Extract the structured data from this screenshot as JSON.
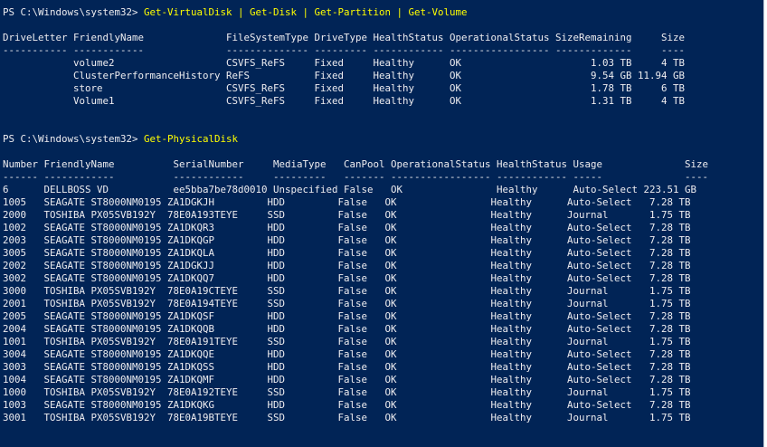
{
  "console": {
    "colors": {
      "background": "#012456",
      "text": "#eeedf0",
      "command": "#ffff00"
    },
    "lines": [
      {
        "type": "command",
        "prompt": "PS C:\\Windows\\system32> ",
        "command": "Get-VirtualDisk | Get-Disk | Get-Partition | Get-Volume"
      },
      {
        "type": "text",
        "text": ""
      },
      {
        "type": "text",
        "text": "DriveLetter FriendlyName              FileSystemType DriveType HealthStatus OperationalStatus SizeRemaining     Size"
      },
      {
        "type": "text",
        "text": "----------- ------------              -------------- --------- ------------ ----------------- -------------     ----"
      },
      {
        "type": "text",
        "text": "            volume2                   CSVFS_ReFS     Fixed     Healthy      OK                      1.03 TB     4 TB"
      },
      {
        "type": "text",
        "text": "            ClusterPerformanceHistory ReFS           Fixed     Healthy      OK                      9.54 GB 11.94 GB"
      },
      {
        "type": "text",
        "text": "            store                     CSVFS_ReFS     Fixed     Healthy      OK                      1.78 TB     6 TB"
      },
      {
        "type": "text",
        "text": "            Volume1                   CSVFS_ReFS     Fixed     Healthy      OK                      1.31 TB     4 TB"
      },
      {
        "type": "text",
        "text": ""
      },
      {
        "type": "text",
        "text": ""
      },
      {
        "type": "command",
        "prompt": "PS C:\\Windows\\system32> ",
        "command": "Get-PhysicalDisk"
      },
      {
        "type": "text",
        "text": ""
      },
      {
        "type": "text",
        "text": "Number FriendlyName          SerialNumber     MediaType   CanPool OperationalStatus HealthStatus Usage              Size"
      },
      {
        "type": "text",
        "text": "------ ------------          ------------     ---------   ------- ----------------- ------------ -----              ----"
      },
      {
        "type": "text",
        "text": "6      DELLBOSS VD           ee5bba7be78d0010 Unspecified False   OK                Healthy      Auto-Select 223.51 GB"
      },
      {
        "type": "text",
        "text": "1005   SEAGATE ST8000NM0195 ZA1DGKJH         HDD         False   OK                Healthy      Auto-Select   7.28 TB"
      },
      {
        "type": "text",
        "text": "2000   TOSHIBA PX05SVB192Y  78E0A193TEYE     SSD         False   OK                Healthy      Journal       1.75 TB"
      },
      {
        "type": "text",
        "text": "1002   SEAGATE ST8000NM0195 ZA1DKQR3         HDD         False   OK                Healthy      Auto-Select   7.28 TB"
      },
      {
        "type": "text",
        "text": "2003   SEAGATE ST8000NM0195 ZA1DKQGP         HDD         False   OK                Healthy      Auto-Select   7.28 TB"
      },
      {
        "type": "text",
        "text": "3005   SEAGATE ST8000NM0195 ZA1DKQLA         HDD         False   OK                Healthy      Auto-Select   7.28 TB"
      },
      {
        "type": "text",
        "text": "2002   SEAGATE ST8000NM0195 ZA1DGKJJ         HDD         False   OK                Healthy      Auto-Select   7.28 TB"
      },
      {
        "type": "text",
        "text": "3002   SEAGATE ST8000NM0195 ZA1DKQQ7         HDD         False   OK                Healthy      Auto-Select   7.28 TB"
      },
      {
        "type": "text",
        "text": "3000   TOSHIBA PX05SVB192Y  78E0A19CTEYE     SSD         False   OK                Healthy      Journal       1.75 TB"
      },
      {
        "type": "text",
        "text": "2001   TOSHIBA PX05SVB192Y  78E0A194TEYE     SSD         False   OK                Healthy      Journal       1.75 TB"
      },
      {
        "type": "text",
        "text": "2005   SEAGATE ST8000NM0195 ZA1DKQSF         HDD         False   OK                Healthy      Auto-Select   7.28 TB"
      },
      {
        "type": "text",
        "text": "2004   SEAGATE ST8000NM0195 ZA1DKQQB         HDD         False   OK                Healthy      Auto-Select   7.28 TB"
      },
      {
        "type": "text",
        "text": "1001   TOSHIBA PX05SVB192Y  78E0A191TEYE     SSD         False   OK                Healthy      Journal       1.75 TB"
      },
      {
        "type": "text",
        "text": "3004   SEAGATE ST8000NM0195 ZA1DKQQE         HDD         False   OK                Healthy      Auto-Select   7.28 TB"
      },
      {
        "type": "text",
        "text": "3003   SEAGATE ST8000NM0195 ZA1DKQSS         HDD         False   OK                Healthy      Auto-Select   7.28 TB"
      },
      {
        "type": "text",
        "text": "1004   SEAGATE ST8000NM0195 ZA1DKQMF         HDD         False   OK                Healthy      Auto-Select   7.28 TB"
      },
      {
        "type": "text",
        "text": "1000   TOSHIBA PX05SVB192Y  78E0A192TEYE     SSD         False   OK                Healthy      Journal       1.75 TB"
      },
      {
        "type": "text",
        "text": "1003   SEAGATE ST8000NM0195 ZA1DKQKG         HDD         False   OK                Healthy      Auto-Select   7.28 TB"
      },
      {
        "type": "text",
        "text": "3001   TOSHIBA PX05SVB192Y  78E0A19BTEYE     SSD         False   OK                Healthy      Journal       1.75 TB"
      }
    ]
  }
}
